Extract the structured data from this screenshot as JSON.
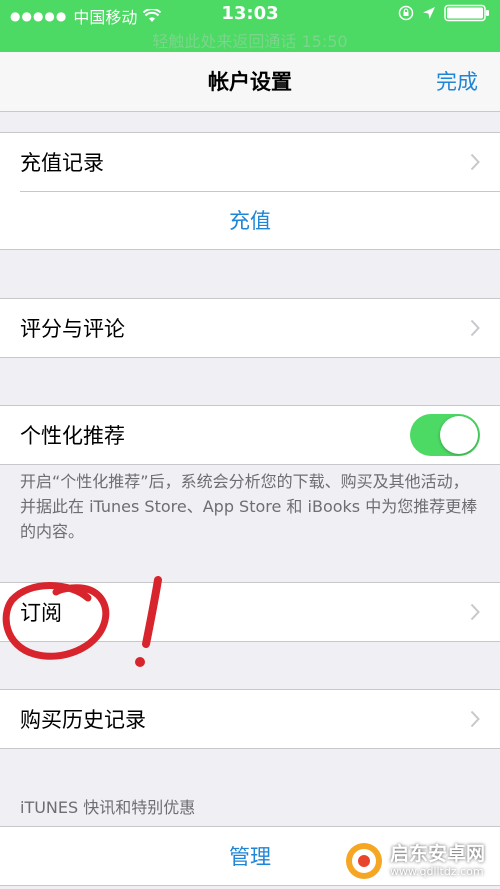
{
  "status_bar": {
    "signal_dots": "●●●●●",
    "carrier": "中国移动",
    "time": "13:03",
    "call_banner": "轻触此处来返回通话 15:50"
  },
  "nav": {
    "title": "帐户设置",
    "done_label": "完成"
  },
  "groups": {
    "recharge": {
      "history_label": "充值记录",
      "recharge_label": "充值"
    },
    "ratings_label": "评分与评论",
    "personalized": {
      "label": "个性化推荐",
      "toggle_on": true,
      "footnote": "开启“个性化推荐”后，系统会分析您的下载、购买及其他活动，并据此在 iTunes Store、App Store 和 iBooks 中为您推荐更棒的内容。"
    },
    "subscriptions_label": "订阅",
    "purchase_history_label": "购买历史记录",
    "itunes_section_header": "iTUNES 快讯和特别优惠",
    "manage_label": "管理"
  },
  "watermark": {
    "text": "启东安卓网",
    "url": "www.qdlltdz.com"
  },
  "colors": {
    "status_green": "#4cd964",
    "link_blue": "#1f85d6",
    "background": "#efeff4",
    "annotation_red": "#d8242c"
  }
}
